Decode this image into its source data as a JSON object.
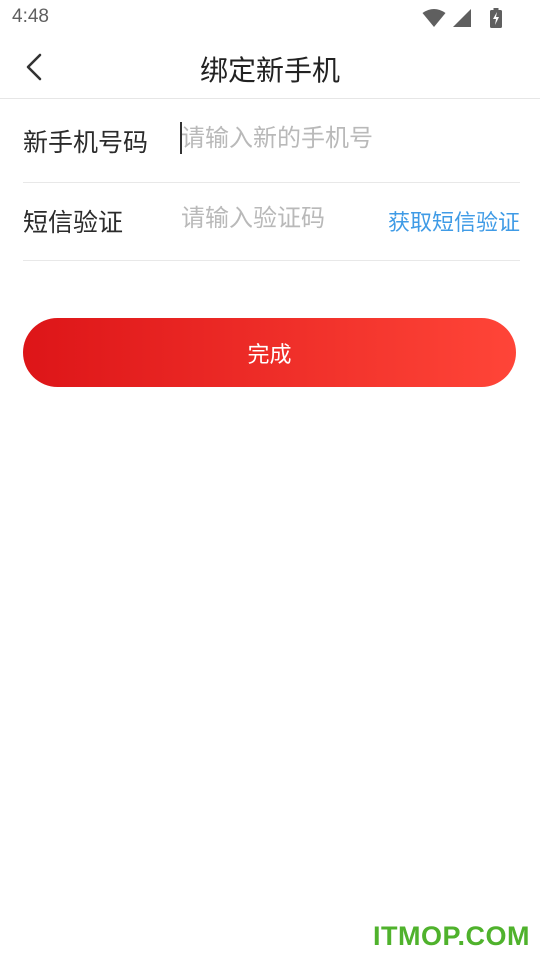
{
  "status_bar": {
    "time": "4:48",
    "icons": [
      "wifi-icon",
      "cell-signal-icon",
      "battery-charging-icon"
    ]
  },
  "header": {
    "title": "绑定新手机",
    "back_icon": "chevron-left-icon"
  },
  "form": {
    "phone": {
      "label": "新手机号码",
      "placeholder": "请输入新的手机号",
      "value": ""
    },
    "code": {
      "label": "短信验证",
      "placeholder": "请输入验证码",
      "value": "",
      "action_label": "获取短信验证"
    }
  },
  "submit": {
    "label": "完成"
  },
  "watermark": "ITMOP.COM",
  "colors": {
    "accent_start": "#dd1518",
    "accent_end": "#ff4538",
    "link": "#3f9be6",
    "watermark": "#4fb22c"
  }
}
